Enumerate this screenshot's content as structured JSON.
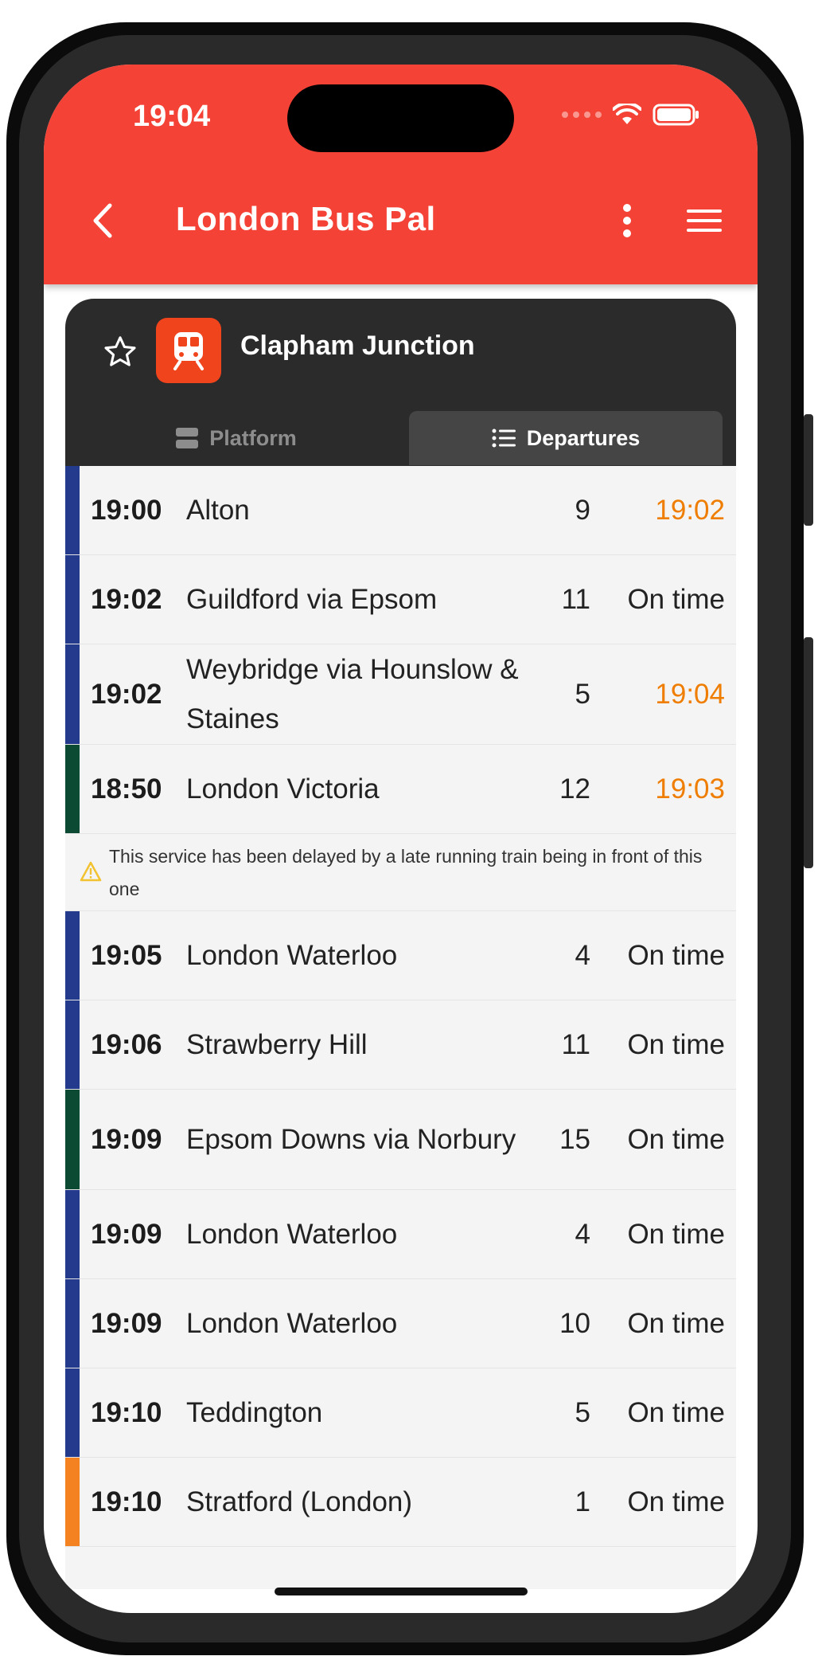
{
  "status_bar": {
    "time": "19:04"
  },
  "app_bar": {
    "title": "London Bus Pal"
  },
  "station": {
    "name": "Clapham Junction"
  },
  "tabs": {
    "platform": "Platform",
    "departures": "Departures"
  },
  "colors": {
    "header": "#f44336",
    "station_icon": "#f0441d",
    "late": "#ef7d00",
    "operator_blue": "#243a8c",
    "operator_green": "#0d4a34",
    "operator_orange": "#f58220"
  },
  "departures": [
    {
      "time": "19:00",
      "destination": "Alton",
      "platform": "9",
      "expected": "19:02",
      "late": true,
      "color": "#243a8c"
    },
    {
      "time": "19:02",
      "destination": "Guildford via Epsom",
      "platform": "11",
      "expected": "On time",
      "late": false,
      "color": "#243a8c"
    },
    {
      "time": "19:02",
      "destination": "Weybridge via Hounslow & Staines",
      "platform": "5",
      "expected": "19:04",
      "late": true,
      "color": "#243a8c"
    },
    {
      "time": "18:50",
      "destination": "London Victoria",
      "platform": "12",
      "expected": "19:03",
      "late": true,
      "color": "#0d4a34"
    },
    {
      "time": "19:05",
      "destination": "London Waterloo",
      "platform": "4",
      "expected": "On time",
      "late": false,
      "color": "#243a8c"
    },
    {
      "time": "19:06",
      "destination": "Strawberry Hill",
      "platform": "11",
      "expected": "On time",
      "late": false,
      "color": "#243a8c"
    },
    {
      "time": "19:09",
      "destination": "Epsom Downs via Norbury",
      "platform": "15",
      "expected": "On time",
      "late": false,
      "color": "#0d4a34"
    },
    {
      "time": "19:09",
      "destination": "London Waterloo",
      "platform": "4",
      "expected": "On time",
      "late": false,
      "color": "#243a8c"
    },
    {
      "time": "19:09",
      "destination": "London Waterloo",
      "platform": "10",
      "expected": "On time",
      "late": false,
      "color": "#243a8c"
    },
    {
      "time": "19:10",
      "destination": "Teddington",
      "platform": "5",
      "expected": "On time",
      "late": false,
      "color": "#243a8c"
    },
    {
      "time": "19:10",
      "destination": "Stratford (London)",
      "platform": "1",
      "expected": "On time",
      "late": false,
      "color": "#f58220"
    }
  ],
  "notice": {
    "text": "This service has been delayed by a late running train being in front of this one"
  }
}
